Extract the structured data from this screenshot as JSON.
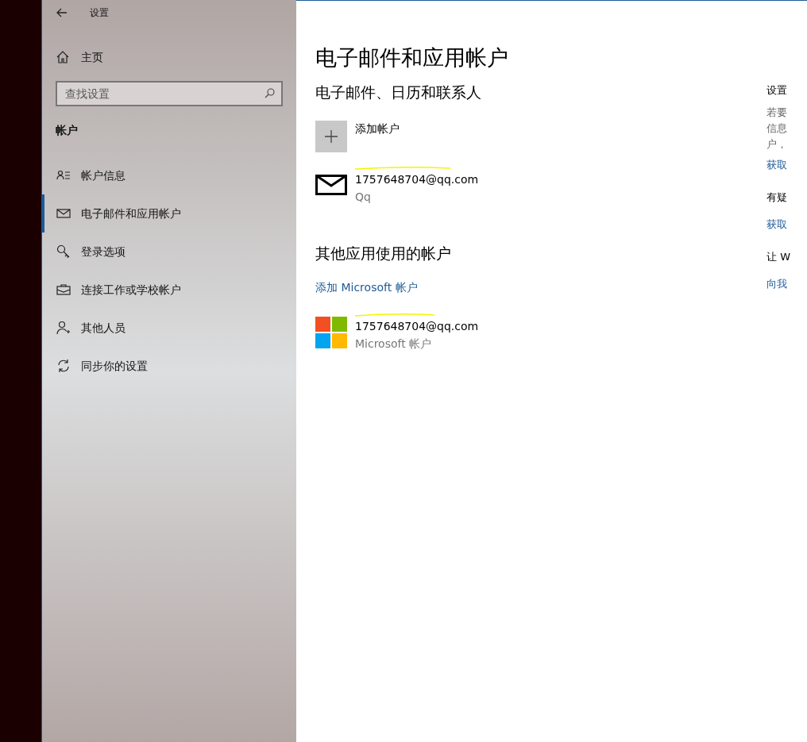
{
  "window": {
    "title": "设置"
  },
  "sidebar": {
    "home": "主页",
    "search": {
      "placeholder": "查找设置"
    },
    "section": "帐户",
    "items": [
      {
        "label": "帐户信息",
        "selected": false
      },
      {
        "label": "电子邮件和应用帐户",
        "selected": true
      },
      {
        "label": "登录选项",
        "selected": false
      },
      {
        "label": "连接工作或学校帐户",
        "selected": false
      },
      {
        "label": "其他人员",
        "selected": false
      },
      {
        "label": "同步你的设置",
        "selected": false
      }
    ]
  },
  "main": {
    "title": "电子邮件和应用帐户",
    "section1": "电子邮件、日历和联系人",
    "add_account": "添加帐户",
    "email_account": {
      "email": "1757648704@qq.com",
      "provider": "Qq"
    },
    "section2": "其他应用使用的帐户",
    "add_microsoft": "添加 Microsoft 帐户",
    "microsoft_account": {
      "email": "1757648704@qq.com",
      "provider": "Microsoft 帐户"
    }
  },
  "right_panel": [
    {
      "kind": "heading",
      "text": "设置"
    },
    {
      "kind": "body",
      "text": "若要"
    },
    {
      "kind": "body",
      "text": "信息"
    },
    {
      "kind": "body",
      "text": "户，"
    },
    {
      "kind": "link",
      "text": "获取"
    },
    {
      "kind": "heading",
      "text": "有疑"
    },
    {
      "kind": "link",
      "text": "获取"
    },
    {
      "kind": "heading",
      "text": "让 W"
    },
    {
      "kind": "link",
      "text": "向我"
    }
  ]
}
